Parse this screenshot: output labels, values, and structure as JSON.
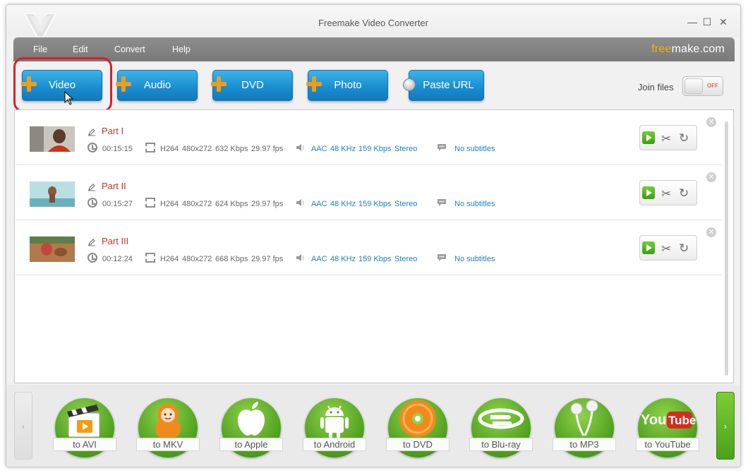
{
  "window": {
    "title": "Freemake Video Converter",
    "controls": [
      "—",
      "☐",
      "✕"
    ]
  },
  "menu": {
    "items": [
      "File",
      "Edit",
      "Convert",
      "Help"
    ],
    "brand_free": "free",
    "brand_rest": "make.com"
  },
  "toolbar": {
    "buttons": [
      {
        "label": "Video"
      },
      {
        "label": "Audio"
      },
      {
        "label": "DVD"
      },
      {
        "label": "Photo"
      },
      {
        "label": "Paste URL"
      }
    ],
    "join_files": {
      "label": "Join files",
      "state": "OFF"
    }
  },
  "files": [
    {
      "name": "Part I",
      "duration": "00:15:15",
      "codec": "H264",
      "resolution": "480x272",
      "bitrate": "632 Kbps",
      "fps": "29.97 fps",
      "audio_codec": "AAC",
      "audio_rate": "48 KHz",
      "audio_bitrate": "159 Kbps",
      "audio_channels": "Stereo",
      "subtitles": "No subtitles"
    },
    {
      "name": "Part II",
      "duration": "00:15:27",
      "codec": "H264",
      "resolution": "480x272",
      "bitrate": "624 Kbps",
      "fps": "29.97 fps",
      "audio_codec": "AAC",
      "audio_rate": "48 KHz",
      "audio_bitrate": "159 Kbps",
      "audio_channels": "Stereo",
      "subtitles": "No subtitles"
    },
    {
      "name": "Part III",
      "duration": "00:12:24",
      "codec": "H264",
      "resolution": "480x272",
      "bitrate": "668 Kbps",
      "fps": "29.97 fps",
      "audio_codec": "AAC",
      "audio_rate": "48 KHz",
      "audio_bitrate": "159 Kbps",
      "audio_channels": "Stereo",
      "subtitles": "No subtitles"
    }
  ],
  "formats": [
    {
      "label": "to AVI",
      "icon": "clapperboard-icon"
    },
    {
      "label": "to MKV",
      "icon": "matryoshka-icon"
    },
    {
      "label": "to Apple",
      "icon": "apple-icon"
    },
    {
      "label": "to Android",
      "icon": "android-icon"
    },
    {
      "label": "to DVD",
      "icon": "dvd-disc-icon"
    },
    {
      "label": "to Blu-ray",
      "icon": "bluray-icon"
    },
    {
      "label": "to MP3",
      "icon": "earphones-icon"
    },
    {
      "label": "to YouTube",
      "icon": "youtube-icon"
    }
  ],
  "icons": {
    "edit": "pencil-icon",
    "duration": "clock-icon",
    "video": "film-icon",
    "audio": "speaker-icon",
    "subtitles": "speech-bubble-icon",
    "play": "play-icon",
    "cut": "scissors-icon",
    "rotate": "rotate-icon",
    "remove": "close-icon"
  },
  "colors": {
    "accent_blue": "#1a8fd1",
    "plus_orange": "#f39c12",
    "green": "#4c9d1c",
    "file_name_red": "#c0392b",
    "link_blue": "#1f7fc1",
    "highlight_red": "#d6212b"
  }
}
